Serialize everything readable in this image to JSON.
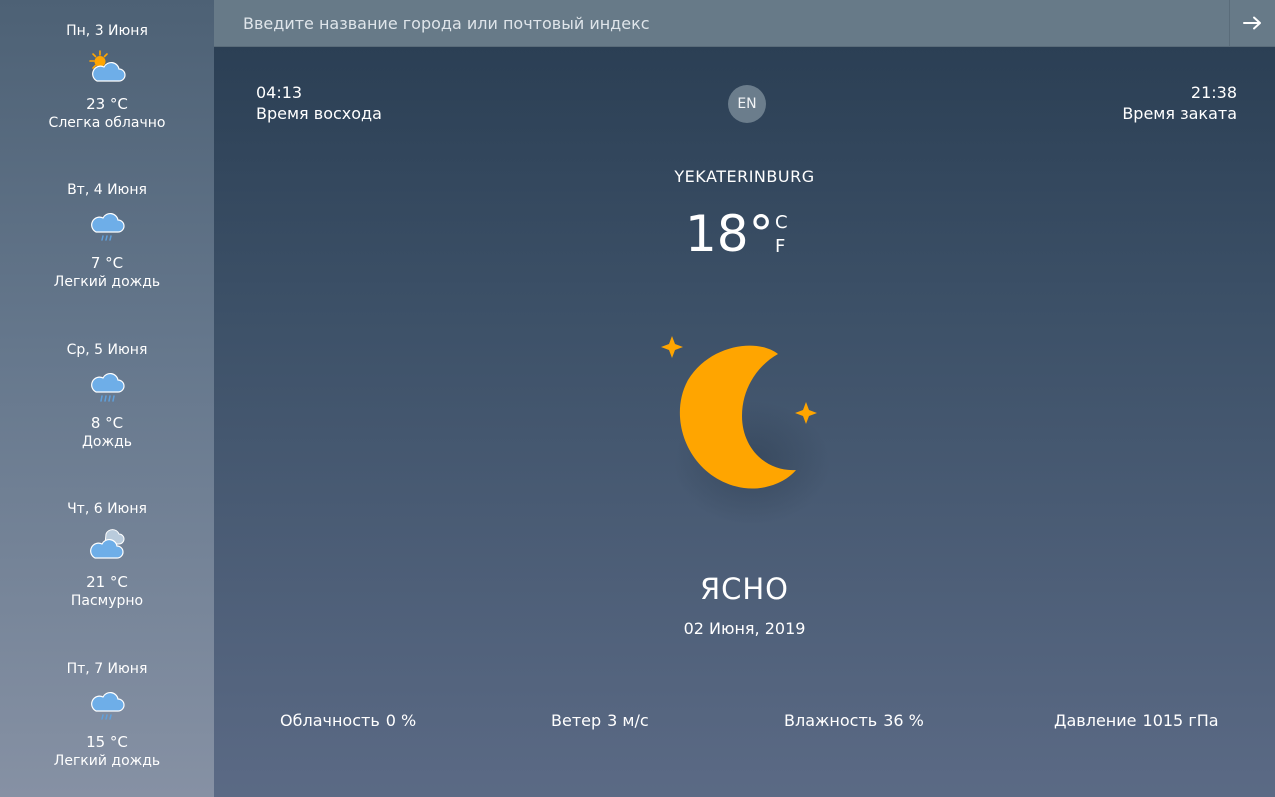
{
  "forecast": [
    {
      "date": "Пн, 3 Июня",
      "temp": "23 °C",
      "condition": "Слегка облачно",
      "icon": "partly-cloudy-icon"
    },
    {
      "date": "Вт, 4 Июня",
      "temp": "7 °C",
      "condition": "Легкий дождь",
      "icon": "light-rain-icon"
    },
    {
      "date": "Ср, 5 Июня",
      "temp": "8 °C",
      "condition": "Дождь",
      "icon": "rain-icon"
    },
    {
      "date": "Чт, 6 Июня",
      "temp": "21 °C",
      "condition": "Пасмурно",
      "icon": "overcast-icon"
    },
    {
      "date": "Пт, 7 Июня",
      "temp": "15 °C",
      "condition": "Легкий дождь",
      "icon": "light-rain-icon"
    }
  ],
  "search": {
    "placeholder": "Введите название города или почтовый индекс",
    "submit_icon": "arrow-right-icon"
  },
  "sun": {
    "sunrise_time": "04:13",
    "sunrise_label": "Время восхода",
    "sunset_time": "21:38",
    "sunset_label": "Время заката"
  },
  "language_toggle": "EN",
  "current": {
    "city": "YEKATERINBURG",
    "temperature": "18°",
    "unit_c": "C",
    "unit_f": "F",
    "icon": "moon-stars-icon",
    "condition": "ЯСНО",
    "date": "02 Июня, 2019"
  },
  "stats": {
    "clouds_label": "Облачность",
    "clouds_value": "0 %",
    "wind_label": "Ветер",
    "wind_value": "3 м/с",
    "humidity_label": "Влажность",
    "humidity_value": "36 %",
    "pressure_label": "Давление",
    "pressure_value": "1015 гПа"
  },
  "colors": {
    "accent_orange": "#FFA500",
    "cloud_blue": "#6eaee8",
    "search_bar": "#677a88"
  }
}
